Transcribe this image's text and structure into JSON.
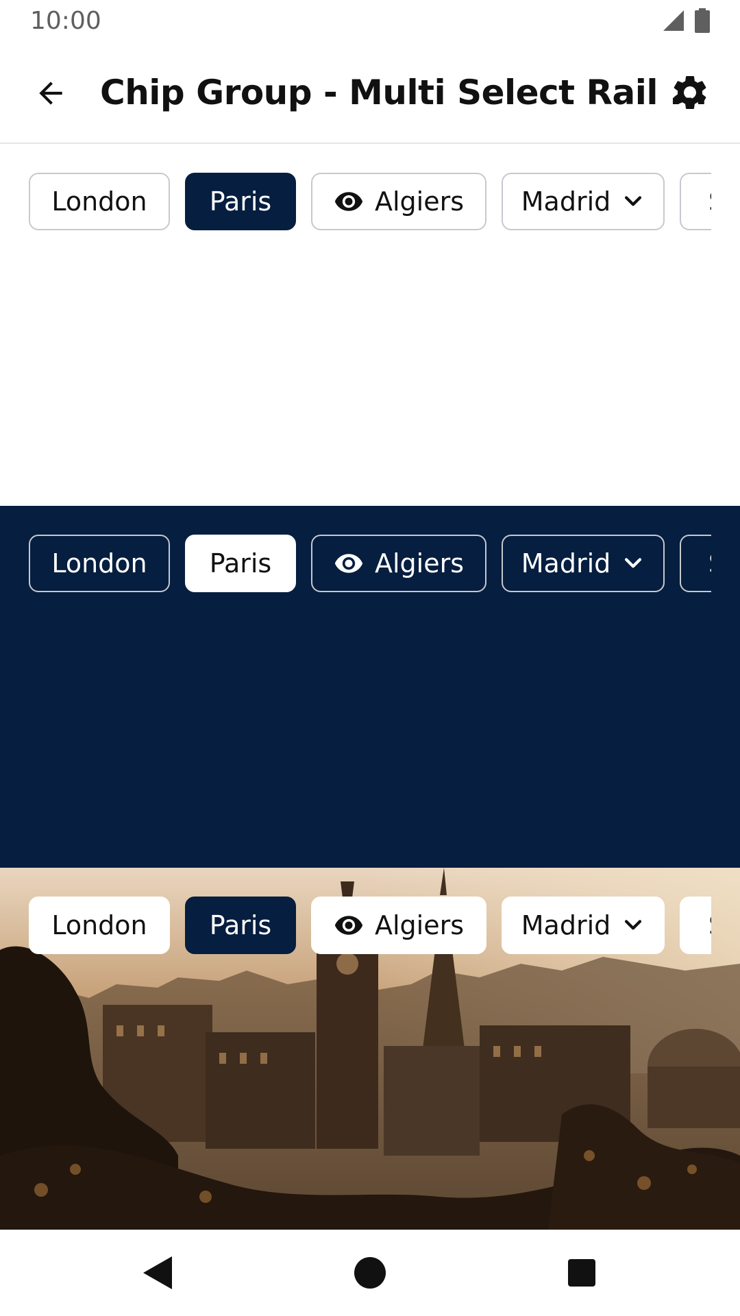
{
  "status_bar": {
    "time": "10:00",
    "icons": [
      "signal-icon",
      "battery-icon"
    ]
  },
  "app_bar": {
    "title": "Chip Group - Multi Select Rail ...",
    "back_icon": "arrow-back-icon",
    "settings_icon": "gear-icon"
  },
  "rails": [
    {
      "theme": "light",
      "chips": [
        {
          "label": "London",
          "selected": false
        },
        {
          "label": "Paris",
          "selected": true
        },
        {
          "label": "Algiers",
          "selected": false,
          "leading_icon": "eye-icon"
        },
        {
          "label": "Madrid",
          "selected": false,
          "trailing_icon": "chevron-down-icon"
        },
        {
          "label": "S",
          "selected": false,
          "partial": true
        }
      ]
    },
    {
      "theme": "dark",
      "chips": [
        {
          "label": "London",
          "selected": false
        },
        {
          "label": "Paris",
          "selected": true
        },
        {
          "label": "Algiers",
          "selected": false,
          "leading_icon": "eye-icon"
        },
        {
          "label": "Madrid",
          "selected": false,
          "trailing_icon": "chevron-down-icon"
        },
        {
          "label": "S",
          "selected": false,
          "partial": true
        }
      ]
    },
    {
      "theme": "image",
      "chips": [
        {
          "label": "London",
          "selected": false
        },
        {
          "label": "Paris",
          "selected": true
        },
        {
          "label": "Algiers",
          "selected": false,
          "leading_icon": "eye-icon"
        },
        {
          "label": "Madrid",
          "selected": false,
          "trailing_icon": "chevron-down-icon"
        },
        {
          "label": "S",
          "selected": false,
          "partial": true
        }
      ]
    }
  ],
  "navigation_bar": {
    "buttons": [
      "back-triangle-icon",
      "home-circle-icon",
      "recents-square-icon"
    ]
  },
  "colors": {
    "brand_navy": "#061e3f",
    "chip_border": "#c6c9cf",
    "text_dark": "#111111"
  }
}
